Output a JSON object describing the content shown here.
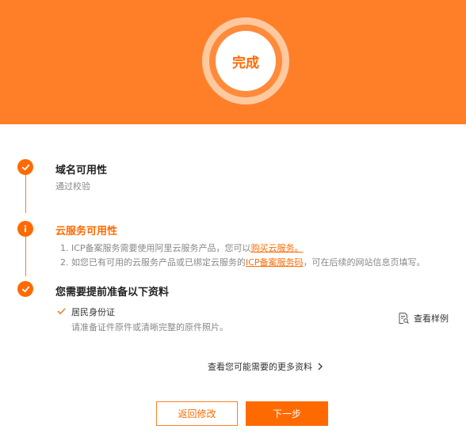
{
  "banner": {
    "badge_label": "完成"
  },
  "steps": [
    {
      "title": "域名可用性",
      "subtitle": "通过校验",
      "status": "passed"
    },
    {
      "title": "云服务可用性",
      "status": "info",
      "note1_prefix": "1. ICP备案服务需要使用阿里云服务产品，您可以",
      "note1_link": "购买云服务。",
      "note2_prefix": "2. 如您已有可用的云服务产品或已绑定云服务的",
      "note2_link": "ICP备案服务码",
      "note2_suffix": "，可在后续的网站信息页填写。"
    },
    {
      "title": "您需要提前准备以下资料",
      "status": "passed"
    }
  ],
  "document": {
    "name": "居民身份证",
    "description": "请准备证件原件或清晰完整的原件照片。",
    "sample_link": "查看样例"
  },
  "more_link": "查看您可能需要的更多资料",
  "buttons": {
    "back": "返回修改",
    "next": "下一步"
  },
  "colors": {
    "brand": "#ff6a00",
    "banner": "#ff7f29"
  },
  "icons": [
    "check-icon",
    "info-icon",
    "check-icon",
    "checkmark-icon",
    "document-search-icon",
    "chevron-right-icon"
  ]
}
